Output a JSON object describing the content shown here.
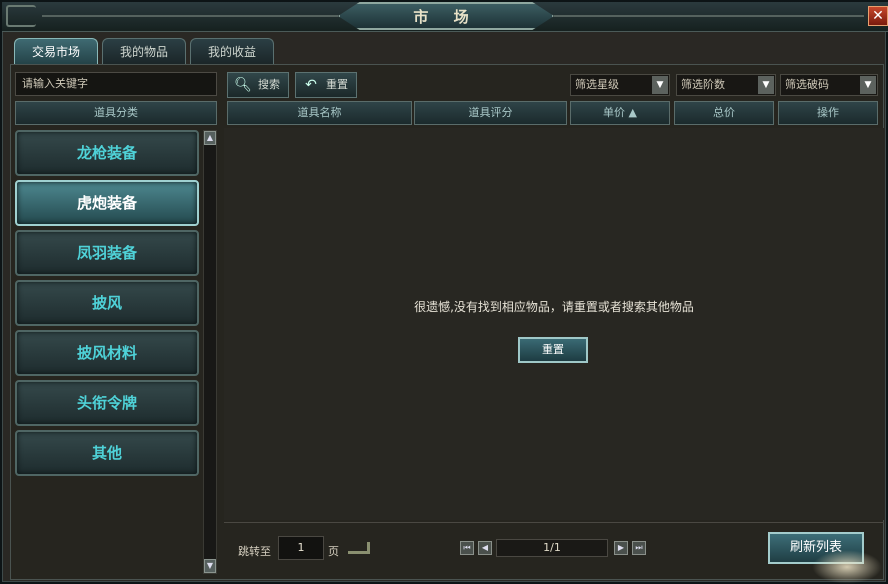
{
  "window": {
    "title": "市 场",
    "close_glyph": "✕"
  },
  "tabs": [
    {
      "label": "交易市场",
      "active": true
    },
    {
      "label": "我的物品",
      "active": false
    },
    {
      "label": "我的收益",
      "active": false
    }
  ],
  "left": {
    "search_placeholder": "请输入关键字",
    "category_header": "道具分类",
    "categories": [
      {
        "label": "龙枪装备",
        "active": false
      },
      {
        "label": "虎炮装备",
        "active": true
      },
      {
        "label": "凤羽装备",
        "active": false
      },
      {
        "label": "披风",
        "active": false
      },
      {
        "label": "披风材料",
        "active": false
      },
      {
        "label": "头衔令牌",
        "active": false
      },
      {
        "label": "其他",
        "active": false
      }
    ],
    "scroll_up": "▲",
    "scroll_down": "▼"
  },
  "toolbar": {
    "search_label": "搜索",
    "search_icon": "magnifier-icon",
    "reset_label": "重置",
    "reset_icon": "undo-arrow-icon",
    "filters": [
      {
        "label": "筛选星级"
      },
      {
        "label": "筛选阶数"
      },
      {
        "label": "筛选破码"
      }
    ],
    "dropdown_glyph": "▼"
  },
  "columns": [
    {
      "label": "道具名称"
    },
    {
      "label": "道具评分"
    },
    {
      "label": "单价 ▲"
    },
    {
      "label": "总价"
    },
    {
      "label": "操作"
    }
  ],
  "empty": {
    "message": "很遗憾,没有找到相应物品，请重置或者搜索其他物品",
    "reset_label": "重置"
  },
  "footer": {
    "jump_label": "跳转至",
    "page_value": "1",
    "page_unit": "页",
    "first": "⏮",
    "prev": "◀",
    "page_indicator": "1/1",
    "next": "▶",
    "last": "⏭",
    "refresh_label": "刷新列表"
  },
  "colors": {
    "accent": "#4fd2d8",
    "panel": "#2a2824",
    "close": "#c7472b"
  }
}
